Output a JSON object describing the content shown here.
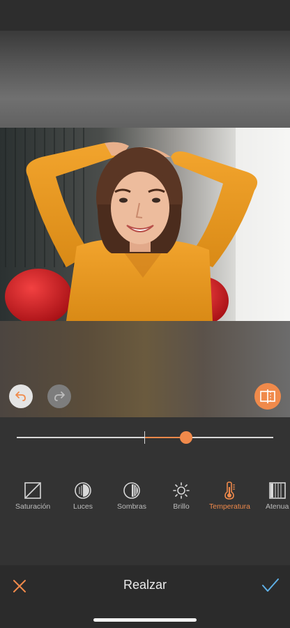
{
  "header": {
    "title": "Realzar"
  },
  "canvas": {
    "image_subject": "photo-woman-yellow-shirt"
  },
  "history": {
    "undo_icon": "undo-arrow-icon",
    "redo_icon": "redo-arrow-icon"
  },
  "compare": {
    "icon": "compare-split-icon"
  },
  "slider": {
    "value_fraction": 0.66
  },
  "tools": [
    {
      "label": "Saturación",
      "icon": "saturation-icon",
      "active": false
    },
    {
      "label": "Luces",
      "icon": "highlights-icon",
      "active": false
    },
    {
      "label": "Sombras",
      "icon": "shadows-icon",
      "active": false
    },
    {
      "label": "Brillo",
      "icon": "brightness-icon",
      "active": false
    },
    {
      "label": "Temperatura",
      "icon": "thermometer-icon",
      "active": true
    },
    {
      "label": "Atenua",
      "icon": "fade-icon",
      "active": false
    }
  ],
  "colors": {
    "accent": "#f08a4b",
    "background": "#333333",
    "bar": "#2b2b2b",
    "confirm": "#5fb0e6"
  }
}
